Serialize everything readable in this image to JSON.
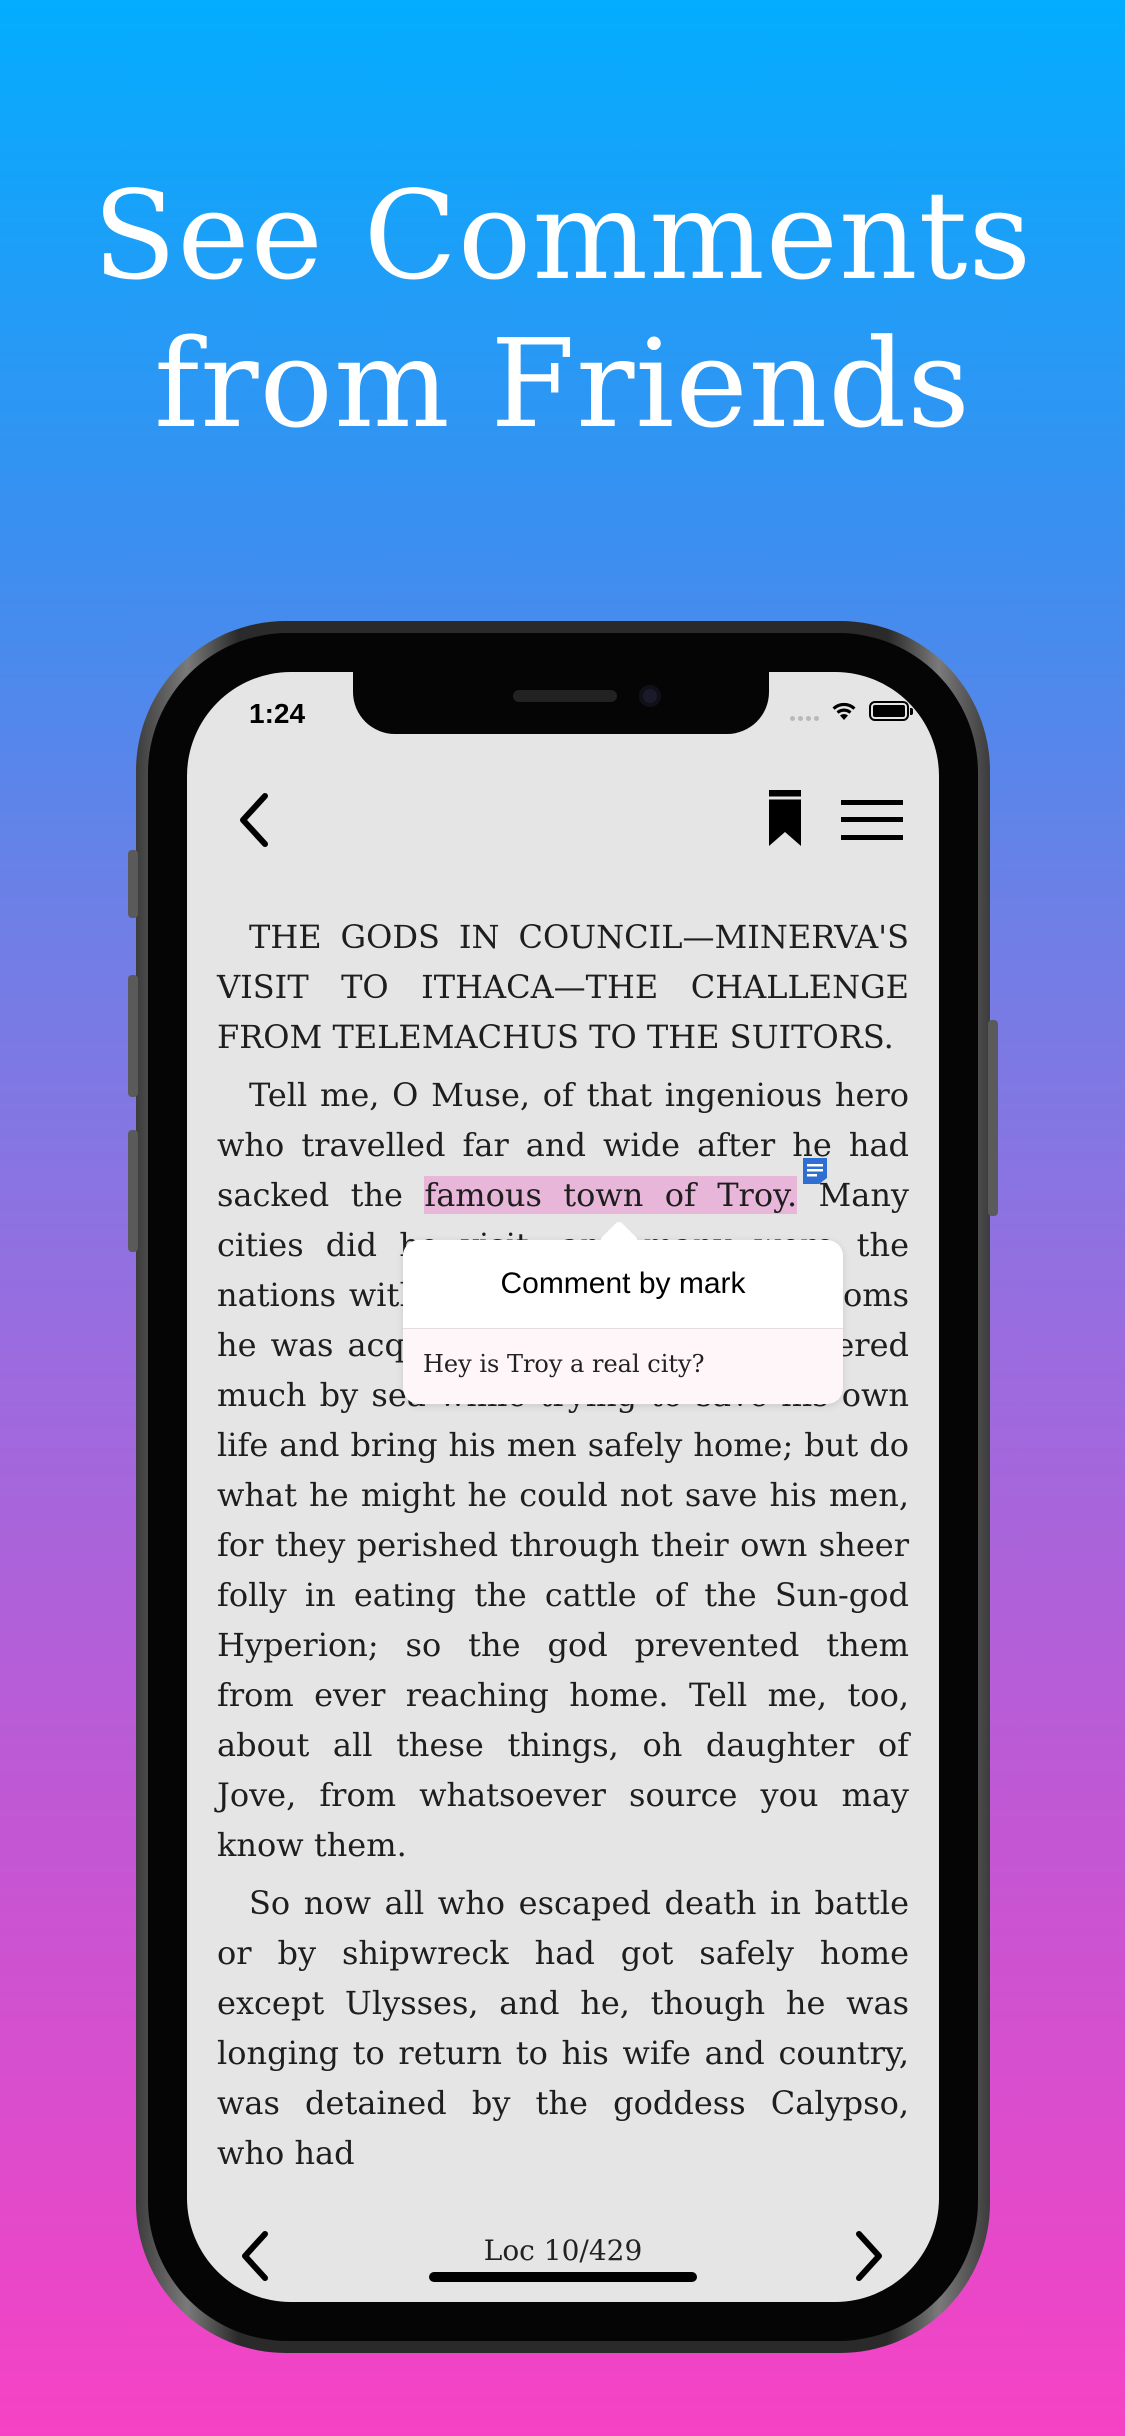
{
  "promo": {
    "headline_line1": "See Comments",
    "headline_line2": "from Friends"
  },
  "status_bar": {
    "time": "1:24",
    "icons": [
      "signal-dots-icon",
      "wifi-icon",
      "battery-icon"
    ]
  },
  "toolbar": {
    "back_icon": "chevron-left-icon",
    "bookmark_icon": "bookmark-icon",
    "menu_icon": "hamburger-menu-icon"
  },
  "reader": {
    "paragraph1": "THE GODS IN COUNCIL—MINERVA'S VISIT TO ITHACA—THE CHALLENGE FROM TELEMACHUS TO THE SUITORS.",
    "paragraph2_before": "Tell me, O Muse, of that ingenious hero who travelled far and wide after he had sacked the ",
    "paragraph2_highlight": "famous town of Troy.",
    "paragraph2_after": " Many cities did he visit, and many were the nations with whose manners and customs he was acquainted; moreover he suffered much by sea while trying to save his own life and bring his men safely home; but do what he might he could not save his men, for they perished through their own sheer folly in eating the cattle of the Sun-god Hyperion; so the god prevented them from ever reaching home. Tell me, too, about all these things, oh daughter of Jove, from whatsoever source you may know them.",
    "paragraph3": "So now all who escaped death in battle or by shipwreck had got safely home except Ulysses, and he, though he was longing to return to his wife and country, was detained by the goddess Calypso, who had",
    "highlight_color": "#e7b6d8",
    "note_icon": "note-icon"
  },
  "comment": {
    "title": "Comment by mark",
    "body": "Hey is Troy a real city?"
  },
  "footer": {
    "location": "Loc 10/429",
    "prev_icon": "chevron-left-icon",
    "next_icon": "chevron-right-icon"
  }
}
